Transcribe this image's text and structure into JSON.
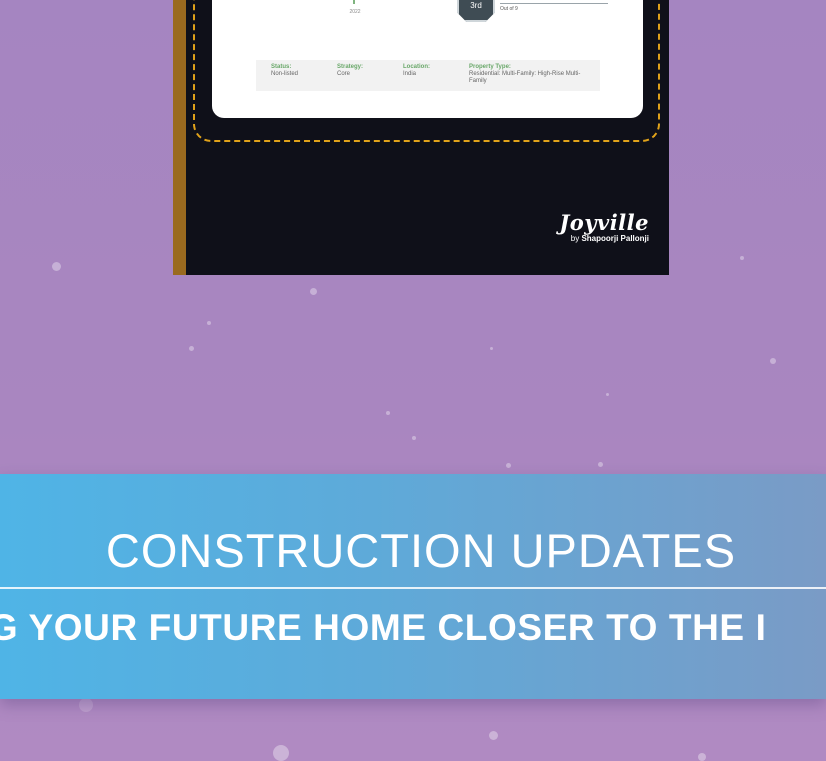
{
  "certificate": {
    "tree_year": "2022",
    "rank": "3rd",
    "rank_out_of": "Out of 9",
    "info": [
      {
        "label": "Status:",
        "value": "Non-listed"
      },
      {
        "label": "Strategy:",
        "value": "Core"
      },
      {
        "label": "Location:",
        "value": "India"
      },
      {
        "label": "Property Type:",
        "value": "Residential: Multi-Family: High-Rise Multi-Family"
      }
    ],
    "logo_name": "Joyville",
    "logo_by": "by",
    "logo_brand": "Shapoorji Pallonji"
  },
  "banner": {
    "title": "CONSTRUCTION UPDATES",
    "subtitle": "IG YOUR FUTURE HOME CLOSER TO THE I"
  },
  "colors": {
    "background": "#a986c0",
    "banner_start": "#4fb4e6",
    "banner_end": "#7a9bc6",
    "poster_bg": "#0f1019",
    "dash_gold": "#e0a21a"
  }
}
